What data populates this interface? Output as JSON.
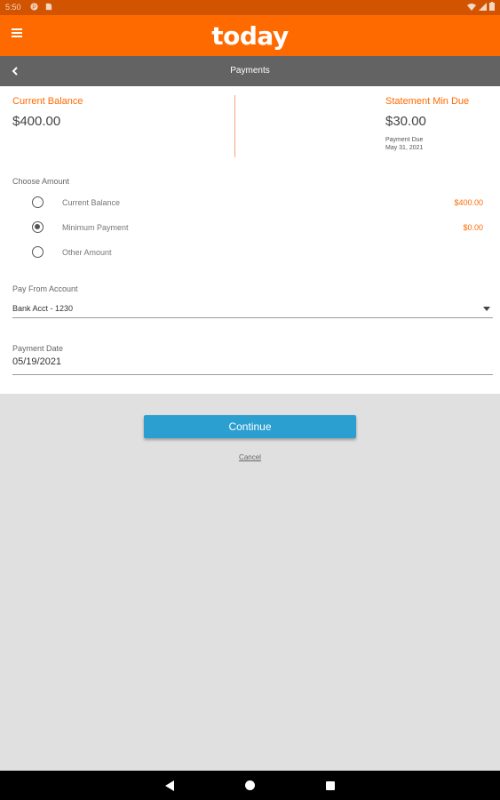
{
  "status_bar": {
    "time": "5:50",
    "icons": [
      "app-notification-icon",
      "sd-card-icon",
      "wifi-icon",
      "signal-icon",
      "battery-icon"
    ]
  },
  "app_bar": {
    "brand": "today",
    "menu_icon": "hamburger-menu-icon",
    "color": "#ff6a00"
  },
  "sub_bar": {
    "title": "Payments",
    "back_icon": "chevron-left-icon"
  },
  "summary": {
    "current_balance_label": "Current Balance",
    "current_balance_value": "$400.00",
    "statement_min_due_label": "Statement Min Due",
    "statement_min_due_value": "$30.00",
    "payment_due_label": "Payment Due",
    "payment_due_date": "May 31, 2021"
  },
  "choose_amount": {
    "label": "Choose Amount",
    "options": [
      {
        "label": "Current Balance",
        "amount": "$400.00",
        "selected": false
      },
      {
        "label": "Minimum Payment",
        "amount": "$0.00",
        "selected": true
      },
      {
        "label": "Other Amount",
        "amount": "",
        "selected": false
      }
    ]
  },
  "pay_from": {
    "label": "Pay From Account",
    "value": "Bank Acct - 1230"
  },
  "payment_date": {
    "label": "Payment Date",
    "value": "05/19/2021"
  },
  "actions": {
    "continue_label": "Continue",
    "cancel_label": "Cancel",
    "continue_color": "#2a9fd0"
  },
  "nav_bar": {
    "icons": [
      "nav-back-icon",
      "nav-home-icon",
      "nav-recents-icon"
    ]
  }
}
